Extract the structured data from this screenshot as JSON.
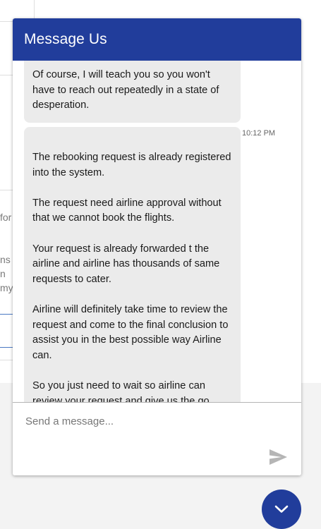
{
  "background_page": {
    "fragments": [
      "for",
      "ns",
      "n",
      "my"
    ]
  },
  "chat": {
    "title": "Message Us",
    "messages": [
      {
        "paragraphs": [
          "Of course, I will teach you so you won't have to reach out repeatedly in a state of desperation."
        ]
      },
      {
        "time": "10:12 PM",
        "paragraphs": [
          "The rebooking request is already registered into the system.",
          "The request need airline approval without that we cannot book the flights.",
          "Your request is already forwarded t the airline and airline has thousands of same requests to cater.",
          "Airline will definitely take time to review the request and come to the final conclusion to assist you in the best possible way Airline can.",
          "So you just need to wait so airline can review your request and give us the go"
        ]
      }
    ],
    "input": {
      "placeholder": "Send a message...",
      "value": ""
    },
    "icons": {
      "send": "send-icon",
      "toggle": "chevron-down-icon"
    },
    "colors": {
      "header": "#213d9b",
      "bubble": "#ebebeb",
      "send_icon": "#b5b5b5"
    }
  }
}
